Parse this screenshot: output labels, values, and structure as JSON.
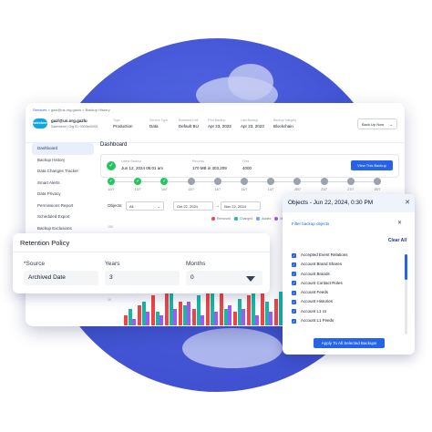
{
  "breadcrumb": {
    "link": "Services",
    "path": "> gazl@us.org.gazlu > Backup History"
  },
  "account": {
    "logo": "salesforce",
    "name": "gazl@us.org.gazlu",
    "org": "Salesforce | Org ID: 00D5e00001",
    "menu": "Back Up Now"
  },
  "meta": [
    {
      "k": "Type",
      "v": "Production"
    },
    {
      "k": "Service Type",
      "v": "Data"
    },
    {
      "k": "Business Unit",
      "v": "Default BU"
    },
    {
      "k": "First Backup",
      "v": "Apr 23, 2023"
    },
    {
      "k": "Last Backup",
      "v": "Apr 23, 2023"
    },
    {
      "k": "Backup Integrity",
      "v": "Blockchain"
    }
  ],
  "sidebar": [
    "Dashboard",
    "Backup History",
    "Data Changes Tracker",
    "Smart Alerts",
    "Data Privacy",
    "Permissions Report",
    "Scheduled Export",
    "Backup Exclusions"
  ],
  "dashboard": {
    "title": "Dashboard",
    "latest_k": "Latest Backup",
    "latest_v": "Jun 12, 2024 05:01 am",
    "records_k": "Records",
    "records_v": "170 MB in 303,209",
    "files_k": "Files",
    "files_v": "4000",
    "view_btn": "View This Backup"
  },
  "timeline": {
    "labels": [
      "10/7",
      "10/7",
      "10/7",
      "12/7",
      "14/7",
      "14/7",
      "14/7",
      "20/7",
      "21/7",
      "27/7",
      "29/7"
    ],
    "done": [
      true,
      true,
      true,
      false,
      false,
      false,
      false,
      false,
      false,
      false,
      false
    ]
  },
  "filter": {
    "label": "Objects:",
    "select": "All",
    "from": "Oct 22, 2024",
    "to": "Nov 22, 2024"
  },
  "legend": [
    {
      "name": "Removed",
      "color": "#ef4444"
    },
    {
      "name": "Changed",
      "color": "#14b8a6"
    },
    {
      "name": "Added",
      "color": "#60a5fa"
    },
    {
      "name": "Moved",
      "color": "#a855f7"
    }
  ],
  "chart_data": {
    "type": "bar",
    "yticks": [
      "150",
      "20",
      "10"
    ],
    "series": [
      {
        "color": "#ef4444",
        "values": [
          6,
          12,
          18,
          24,
          14,
          10,
          20,
          22,
          8,
          18,
          26,
          16
        ]
      },
      {
        "color": "#14b8a6",
        "values": [
          10,
          14,
          8,
          20,
          12,
          18,
          24,
          10,
          16,
          22,
          14,
          20
        ]
      },
      {
        "color": "#a855f7",
        "values": [
          4,
          8,
          6,
          10,
          14,
          6,
          8,
          12,
          10,
          6,
          8,
          10
        ]
      }
    ]
  },
  "retention": {
    "title": "Retention Policy",
    "source_label": "*Source",
    "source_value": "Archived Date",
    "years_label": "Years",
    "years_value": "3",
    "months_label": "Months",
    "months_value": "0"
  },
  "objects": {
    "title": "Objects - Jun 22, 2024, 0:30 PM",
    "filter": "Filter backup objects",
    "clear": "Clear All",
    "items": [
      "Accepted Event Relations",
      "Account Brand Shares",
      "Account Brands",
      "Account Contact Roles",
      "Account Feeds",
      "Account Histories",
      "Account L1 cs",
      "Account L1 Feeds"
    ],
    "apply": "Apply To All Selected Backups"
  }
}
